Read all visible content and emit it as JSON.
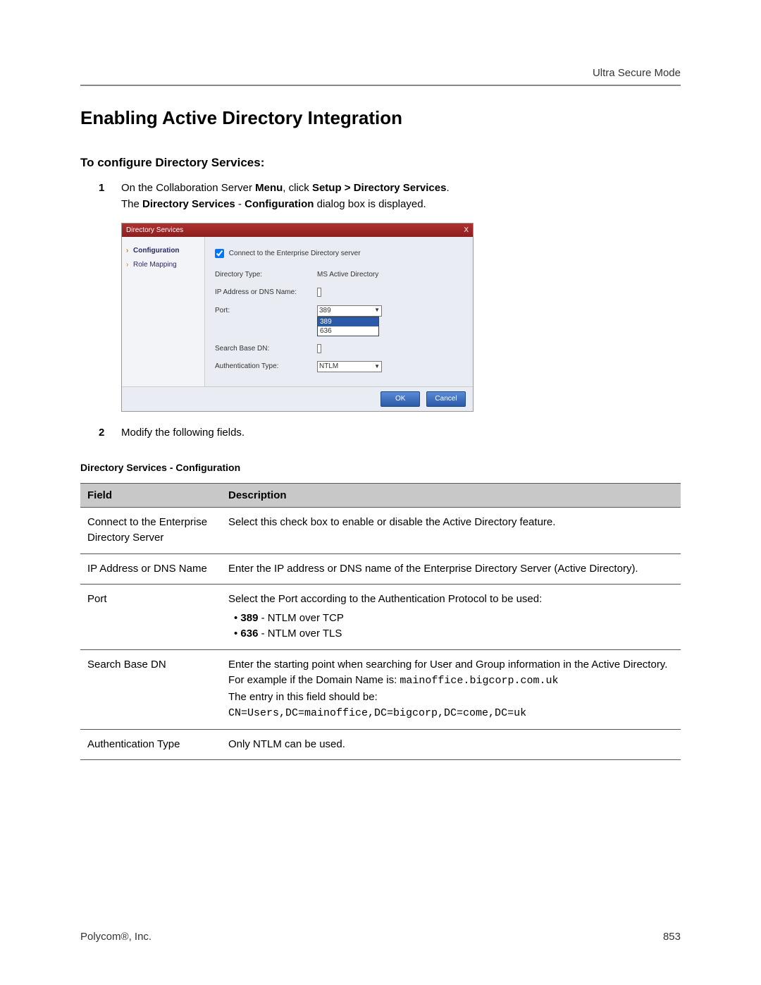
{
  "header": {
    "right": "Ultra Secure Mode"
  },
  "title": "Enabling Active Directory Integration",
  "section_heading": "To configure Directory Services:",
  "steps": {
    "s1": {
      "num": "1",
      "line1_a": "On the Collaboration Server ",
      "line1_b": "Menu",
      "line1_c": ", click ",
      "line1_d": "Setup > Directory Services",
      "line1_e": ".",
      "line2_a": "The ",
      "line2_b": "Directory Services",
      "line2_c": " - ",
      "line2_d": "Configuration",
      "line2_e": " dialog box is displayed."
    },
    "s2": {
      "num": "2",
      "text": "Modify the following fields."
    }
  },
  "dialog": {
    "title": "Directory Services",
    "close": "X",
    "nav": {
      "item1": "Configuration",
      "item2": "Role Mapping"
    },
    "check_label": "Connect to the Enterprise Directory server",
    "labels": {
      "dir_type": "Directory Type:",
      "dir_type_val": "MS Active Directory",
      "ip": "IP Address or DNS Name:",
      "port": "Port:",
      "port_val": "389",
      "port_opt1": "389",
      "port_opt2": "636",
      "search": "Search Base DN:",
      "auth": "Authentication Type:",
      "auth_val": "NTLM"
    },
    "buttons": {
      "ok": "OK",
      "cancel": "Cancel"
    }
  },
  "table": {
    "caption": "Directory Services - Configuration",
    "hdr_field": "Field",
    "hdr_desc": "Description",
    "rows": {
      "r1": {
        "field": "Connect to the Enterprise Directory Server",
        "desc": "Select this check box to enable or disable the Active Directory feature."
      },
      "r2": {
        "field": "IP Address or DNS Name",
        "desc": "Enter the IP address or DNS name of the Enterprise Directory Server (Active Directory)."
      },
      "r3": {
        "field": "Port",
        "desc_intro": "Select the Port according to the Authentication Protocol to be used:",
        "b1_a": "389",
        "b1_b": " - NTLM over TCP",
        "b2_a": "636",
        "b2_b": " - NTLM over TLS"
      },
      "r4": {
        "field": "Search Base DN",
        "p1": "Enter the starting point when searching for User and Group information in the Active Directory.",
        "p2_a": "For example if the Domain Name is: ",
        "p2_b": "mainoffice.bigcorp.com.uk",
        "p3": "The entry in this field should be:",
        "p4": "CN=Users,DC=mainoffice,DC=bigcorp,DC=come,DC=uk"
      },
      "r5": {
        "field": "Authentication Type",
        "desc": "Only NTLM can be used."
      }
    }
  },
  "footer": {
    "left": "Polycom®, Inc.",
    "right": "853"
  }
}
